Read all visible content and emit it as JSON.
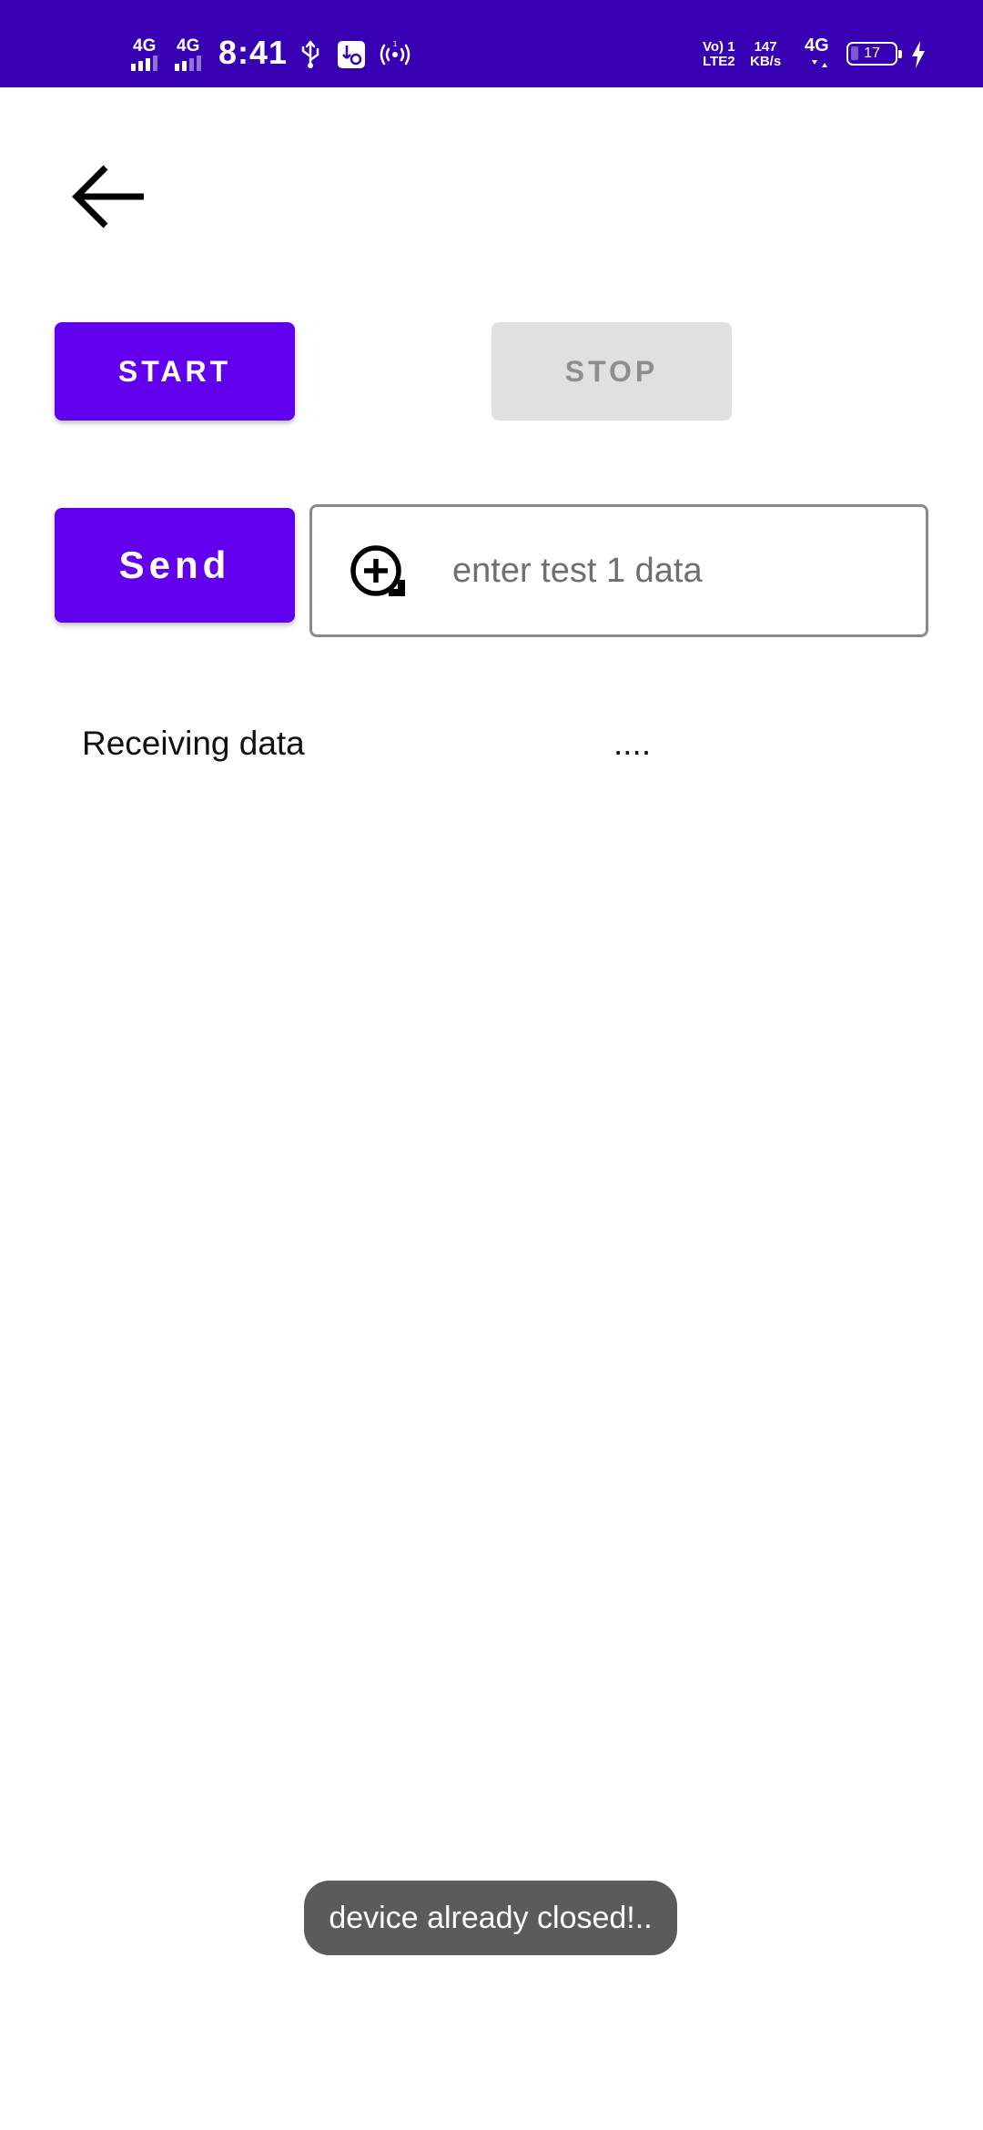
{
  "status_bar": {
    "sim1_network": "4G",
    "sim2_network": "4G",
    "time": "8:41",
    "volte_top": "Vo) 1",
    "volte_bottom": "LTE2",
    "speed_value": "147",
    "speed_unit": "KB/s",
    "data_network": "4G",
    "battery_level": "17",
    "battery_fraction": 0.17,
    "background_color": "#3700b3",
    "icons": [
      "signal-icon",
      "usb-icon",
      "usb-debug-icon",
      "hotspot-icon",
      "data-activity-icon",
      "battery-icon",
      "charging-icon"
    ]
  },
  "toolbar": {
    "back_icon": "arrow-back-icon"
  },
  "controls": {
    "start_label": "START",
    "stop_label": "STOP",
    "send_label": "Send",
    "accent_color": "#6200ee",
    "disabled_color": "#e0e0e0"
  },
  "input": {
    "placeholder": "enter test 1 data",
    "value": "",
    "icon": "add-circle-icon"
  },
  "receiving": {
    "label": "Receiving data",
    "value": "...."
  },
  "toast": {
    "message": "device already closed!.."
  }
}
